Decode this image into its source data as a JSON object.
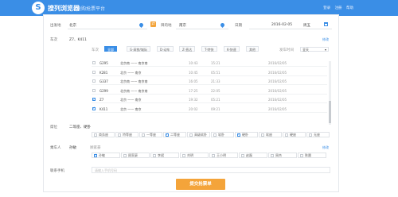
{
  "header": {
    "logo_letter": "S",
    "brand": "搜列浏览器",
    "slogan": "抢购抢票平台",
    "links": [
      "登录",
      "注册",
      "帮助"
    ]
  },
  "route": {
    "from_label": "出发地",
    "from_value": "北京",
    "to_label": "目的地",
    "to_value": "南京",
    "date_label": "日期",
    "date_value": "2016-02-05",
    "weekday": "周五"
  },
  "trains": {
    "label": "车次",
    "selected_value": "Z7、K411",
    "edit_link": "修改",
    "tabs": [
      {
        "label": "全部"
      },
      {
        "label": "G-高铁/城际"
      },
      {
        "label": "D-动车"
      },
      {
        "label": "Z-直达"
      },
      {
        "label": "T-特快"
      },
      {
        "label": "K-快速"
      },
      {
        "label": "其他"
      }
    ],
    "sort_label": "发车时间",
    "sort_value": "全天",
    "columns": [
      "车次",
      "出发站",
      "到达站",
      "出发时间",
      "到达时间",
      "历时",
      "余票"
    ],
    "rows": [
      {
        "code": "G295",
        "route": "北京南 —— 南京南",
        "depart": "10:43",
        "arrive": "15:21",
        "date": "2016/02/05",
        "checked": false
      },
      {
        "code": "K281",
        "route": "北京 —— 南京",
        "depart": "10:45",
        "arrive": "05:51",
        "date": "2016/02/05",
        "checked": false
      },
      {
        "code": "G337",
        "route": "北京南 —— 南京南",
        "depart": "16:05",
        "arrive": "21:33",
        "date": "2016/02/05",
        "checked": false
      },
      {
        "code": "G299",
        "route": "北京南 —— 南京南",
        "depart": "17:25",
        "arrive": "22:05",
        "date": "2016/02/05",
        "checked": false
      },
      {
        "code": "Z7",
        "route": "北京 —— 南京",
        "depart": "19:32",
        "arrive": "05:21",
        "date": "2016/02/05",
        "checked": true
      },
      {
        "code": "K411",
        "route": "北京 —— 南京",
        "depart": "20:02",
        "arrive": "09:21",
        "date": "2016/02/05",
        "checked": true
      }
    ]
  },
  "seats": {
    "label": "席位",
    "selected_value": "二等座、硬卧",
    "options": [
      {
        "label": "商务座",
        "checked": false
      },
      {
        "label": "特等座",
        "checked": false
      },
      {
        "label": "一等座",
        "checked": false
      },
      {
        "label": "二等座",
        "checked": true
      },
      {
        "label": "高级软卧",
        "checked": false
      },
      {
        "label": "软卧",
        "checked": false
      },
      {
        "label": "硬卧",
        "checked": true
      },
      {
        "label": "软座",
        "checked": false
      },
      {
        "label": "硬座",
        "checked": false
      },
      {
        "label": "无座",
        "checked": false
      }
    ]
  },
  "passengers": {
    "label": "乘车人",
    "selected_value": "孙敏",
    "extra_value": "顾家豪",
    "edit_link": "修改",
    "options": [
      {
        "label": "孙敏",
        "checked": true
      },
      {
        "label": "顾家豪",
        "checked": false
      },
      {
        "label": "李斌",
        "checked": false
      },
      {
        "label": "刘明",
        "checked": false
      },
      {
        "label": "王小明",
        "checked": false
      },
      {
        "label": "赵磊",
        "checked": false
      },
      {
        "label": "周杰",
        "checked": false
      },
      {
        "label": "陈晨",
        "checked": false
      }
    ]
  },
  "phone": {
    "label": "联系手机",
    "placeholder": "请输入手机号码"
  },
  "submit_label": "提交抢票单",
  "colors": {
    "accent": "#3a8ee6",
    "submit": "#f4a43a"
  }
}
